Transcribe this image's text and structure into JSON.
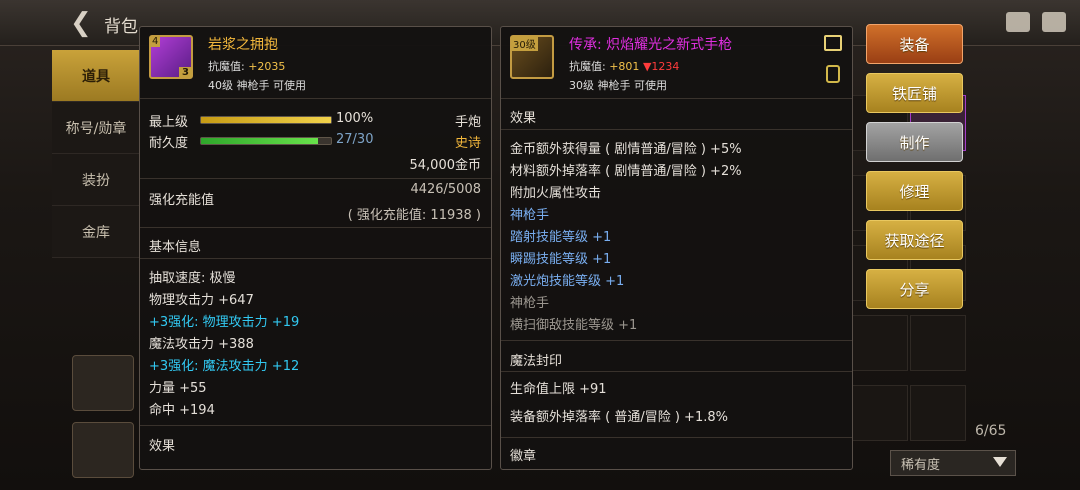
{
  "topbar": {
    "title": "背包"
  },
  "left_tabs": [
    "道具",
    "称号/勋章",
    "装扮",
    "金库"
  ],
  "item1": {
    "name": "岩浆之拥抱",
    "name_color": "#f2b73c",
    "resist_label": "抗魔值:",
    "resist_value": "+2035",
    "level_class": "40级 神枪手 可使用",
    "icon_stack": "3",
    "icon_level": "4",
    "max_level_label": "最上级",
    "max_level_value": "100%",
    "max_level_fill": 1.0,
    "type": "手炮",
    "durability_label": "耐久度",
    "durability_value": "27/30",
    "durability_fill": 0.9,
    "rarity": "史诗",
    "price": "54,000金币",
    "enhance_label": "强化充能值",
    "enhance_value": "4426/5008",
    "enhance_sub": "( 强化充能值: 11938 )",
    "basic_info_label": "基本信息",
    "stats": [
      {
        "text": "抽取速度: 极慢",
        "style": ""
      },
      {
        "text": "物理攻击力 +647",
        "style": ""
      },
      {
        "text": "+3强化: 物理攻击力 +19",
        "style": "cyan"
      },
      {
        "text": "魔法攻击力 +388",
        "style": ""
      },
      {
        "text": "+3强化: 魔法攻击力 +12",
        "style": "cyan"
      },
      {
        "text": "力量 +55",
        "style": ""
      },
      {
        "text": "命中 +194",
        "style": ""
      }
    ],
    "effect_label": "效果"
  },
  "item2": {
    "name": "传承: 炽焰耀光之新式手枪",
    "name_color": "#e02fe0",
    "icon_level": "30级",
    "resist_label": "抗魔值:",
    "resist_value": "+801",
    "resist_down": "▼1234",
    "level_class": "30级 神枪手 可使用",
    "effect_label": "效果",
    "effects": [
      {
        "text": "金币额外获得量 ( 剧情普通/冒险 ) +5%",
        "style": ""
      },
      {
        "text": "材料额外掉落率 ( 剧情普通/冒险 ) +2%",
        "style": ""
      },
      {
        "text": "附加火属性攻击",
        "style": ""
      },
      {
        "text": "神枪手",
        "style": "blue"
      },
      {
        "text": "踏射技能等级 +1",
        "style": "blue"
      },
      {
        "text": "瞬踢技能等级 +1",
        "style": "blue"
      },
      {
        "text": "激光炮技能等级 +1",
        "style": "blue"
      },
      {
        "text": "神枪手",
        "style": "gray"
      },
      {
        "text": "横扫御敌技能等级 +1",
        "style": "gray"
      }
    ],
    "seal_label": "魔法封印",
    "seal_lines": [
      "生命值上限 +91",
      "装备额外掉落率 ( 普通/冒险 ) +1.8%"
    ],
    "emblem_label": "徽章"
  },
  "actions": [
    "装备",
    "铁匠铺",
    "制作",
    "修理",
    "获取途径",
    "分享"
  ],
  "inventory": {
    "count": "6/65",
    "sort_label": "稀有度"
  }
}
